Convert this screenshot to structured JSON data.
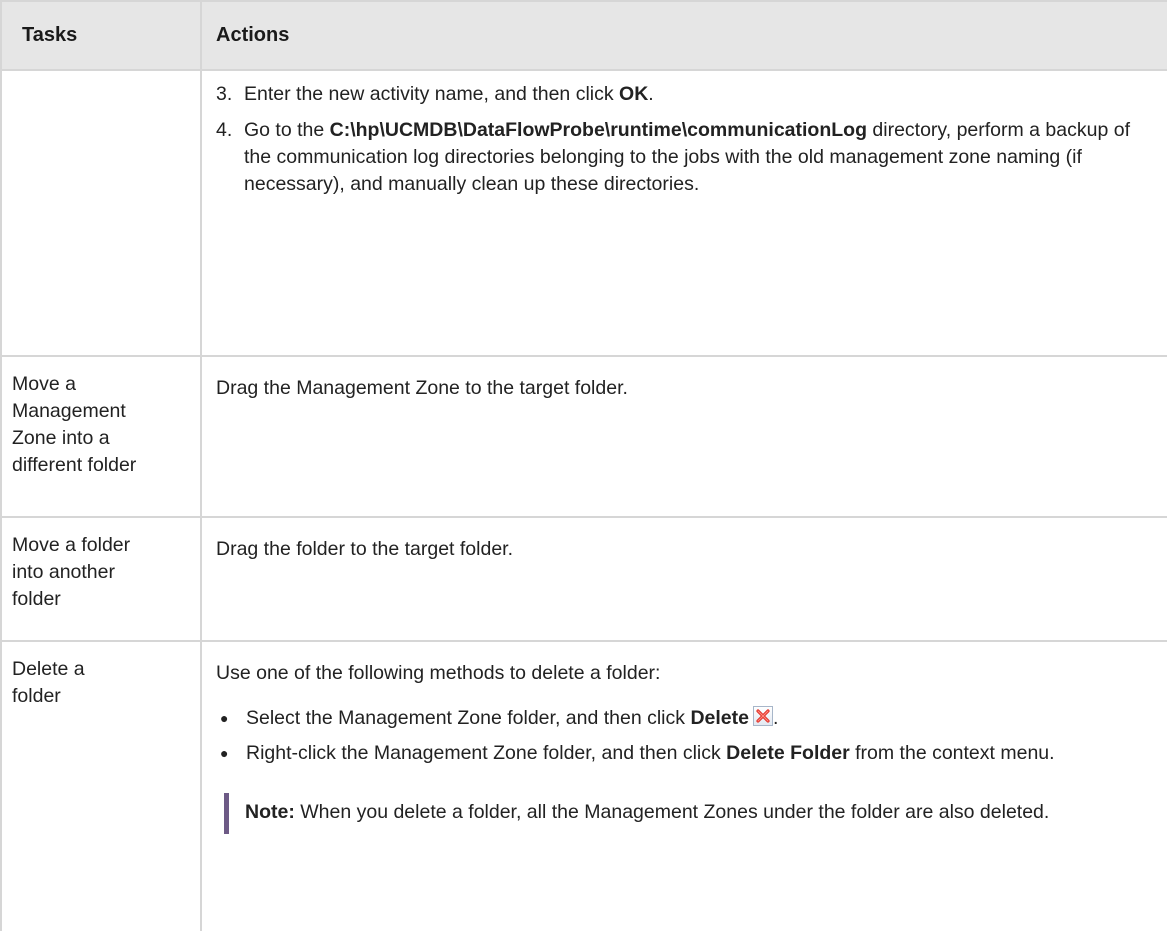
{
  "headers": {
    "tasks": "Tasks",
    "actions": "Actions"
  },
  "row_cont": {
    "step3": {
      "num": "3.",
      "text_a": "Enter the new activity name, and then click ",
      "bold": "OK",
      "text_b": "."
    },
    "step4": {
      "num": "4.",
      "text_a": "Go to the ",
      "bold": "C:\\hp\\UCMDB\\DataFlowProbe\\runtime\\communicationLog",
      "text_b": " directory, perform a backup of the communication log directories belonging to the jobs with the old management zone naming (if necessary), and manually clean up these directories."
    }
  },
  "row_move_zone": {
    "task_lines": [
      "Move a",
      "Management",
      "Zone into a",
      "different folder"
    ],
    "action": "Drag the Management Zone to the target folder."
  },
  "row_move_folder": {
    "task_lines": [
      "Move a folder",
      "into another",
      "folder"
    ],
    "action": "Drag the folder to the target folder."
  },
  "row_delete": {
    "task_lines": [
      "Delete a",
      "folder"
    ],
    "intro": "Use one of the following methods to delete a folder:",
    "bullet1": {
      "text_a": "Select the Management Zone folder, and then click ",
      "bold": "Delete",
      "text_b": ".",
      "icon": "delete-icon"
    },
    "bullet2": {
      "text_a": "Right-click the Management Zone folder, and then click ",
      "bold": "Delete Folder",
      "text_b": " from the context menu."
    },
    "note": {
      "label": "Note:",
      "text": " When you delete a folder, all the Management Zones under the folder are also deleted."
    }
  },
  "colors": {
    "header_bg": "#e6e6e6",
    "border": "#d6d6d6",
    "note_bar": "#6d5a86",
    "delete_x": "#e2342b"
  }
}
